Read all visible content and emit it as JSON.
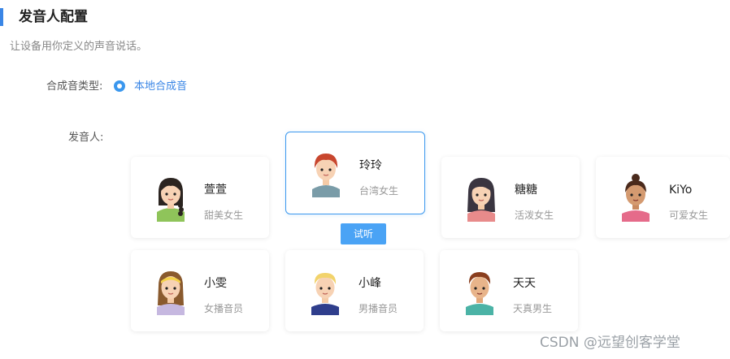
{
  "header": {
    "title": "发音人配置",
    "description": "让设备用你定义的声音说话。"
  },
  "synth_type": {
    "label": "合成音类型:",
    "selected_option": "本地合成音"
  },
  "speakers": {
    "label": "发音人:",
    "try_button": "试听",
    "cards": [
      {
        "name": "萱萱",
        "desc": "甜美女生",
        "avatar": "girl-braid-avatar-icon"
      },
      {
        "name": "玲玲",
        "desc": "台湾女生",
        "avatar": "girl-red-hair-avatar-icon",
        "selected": true
      },
      {
        "name": "糖糖",
        "desc": "活泼女生",
        "avatar": "girl-long-hair-avatar-icon"
      },
      {
        "name": "KiYo",
        "desc": "可爱女生",
        "avatar": "girl-bun-avatar-icon"
      },
      {
        "name": "小雯",
        "desc": "女播音员",
        "avatar": "girl-headband-avatar-icon"
      },
      {
        "name": "小峰",
        "desc": "男播音员",
        "avatar": "boy-blond-avatar-icon"
      },
      {
        "name": "天天",
        "desc": "天真男生",
        "avatar": "boy-brown-avatar-icon"
      }
    ]
  },
  "watermark": "CSDN @远望创客学堂",
  "colors": {
    "accent": "#3a97ee",
    "button": "#4aa3f5"
  }
}
